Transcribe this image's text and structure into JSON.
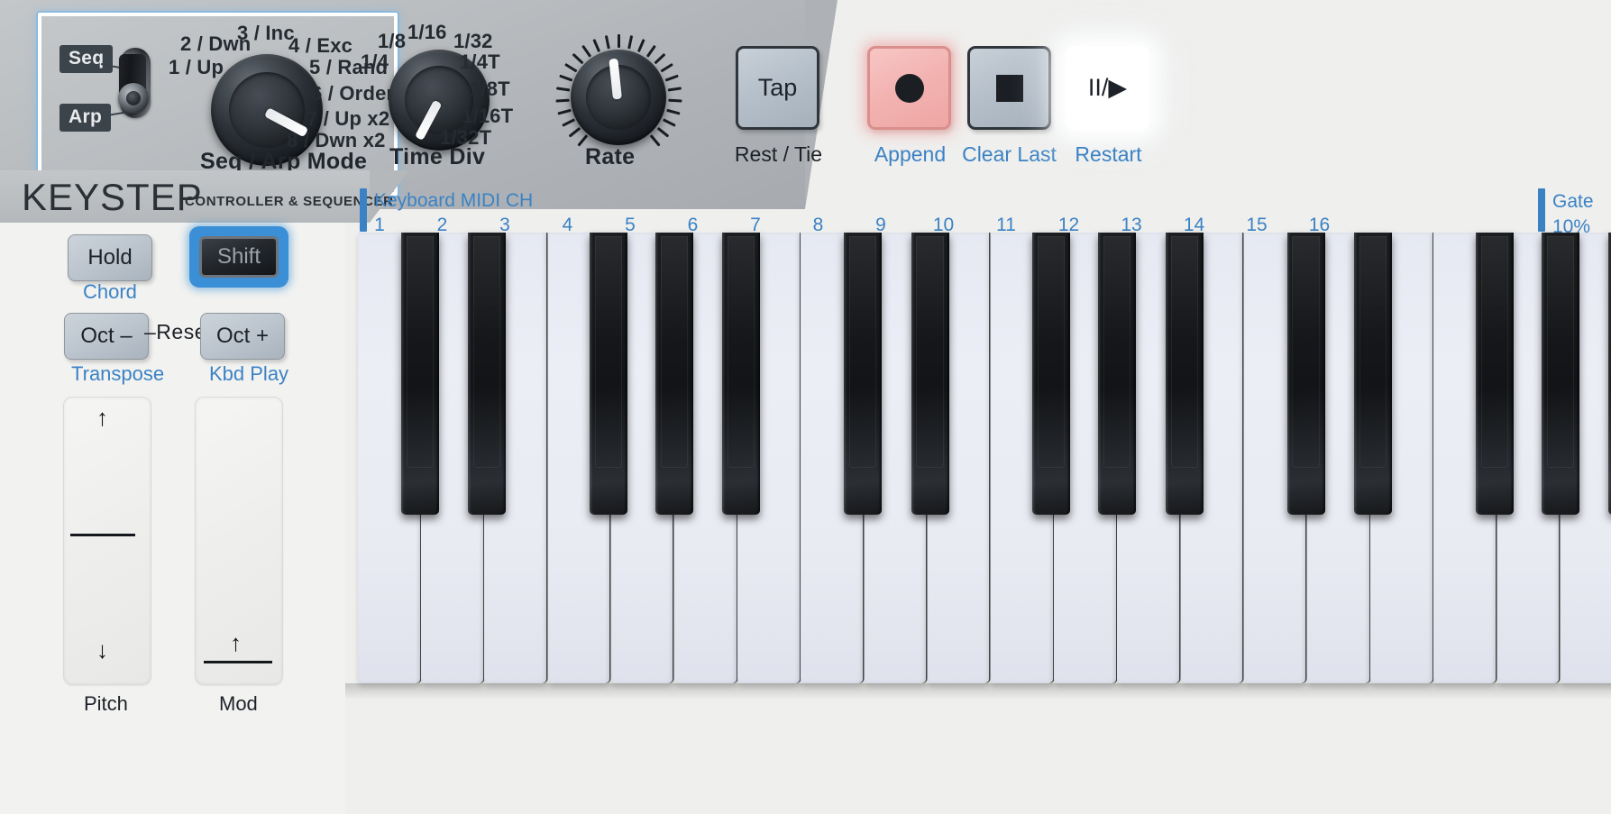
{
  "device": {
    "brand_name": "KEYSTEP",
    "brand_subtitle": "CONTROLLER & SEQUENCER"
  },
  "seq_arp_section": {
    "panel_title": "Seq / Arp Mode",
    "toggle": {
      "top_label": "Seq",
      "bottom_label": "Arp",
      "position": "Arp"
    },
    "mode_options": [
      "1 / Up",
      "2 / Dwn",
      "3 / Inc",
      "4 / Exc",
      "5 / Rand",
      "6 / Order",
      "7 / Up x2",
      "8 / Dwn x2"
    ]
  },
  "time_div_section": {
    "title": "Time Div",
    "options": [
      "1/4",
      "1/8",
      "1/16",
      "1/32",
      "1/4T",
      "1/8T",
      "1/16T",
      "1/32T"
    ]
  },
  "rate_section": {
    "title": "Rate"
  },
  "transport": {
    "buttons": [
      {
        "label": "Tap",
        "icon": "text",
        "caption": "Rest / Tie",
        "caption_color": "#1d2228",
        "state": "normal"
      },
      {
        "label": "",
        "icon": "record-icon",
        "caption": "Append",
        "caption_color": "#3b82c4",
        "state": "lit-red"
      },
      {
        "label": "",
        "icon": "stop-icon",
        "caption": "Clear Last",
        "caption_color": "#3b82c4",
        "state": "normal"
      },
      {
        "label": "II/▶",
        "icon": "pause-play-icon",
        "caption": "Restart",
        "caption_color": "#3b82c4",
        "state": "lit-white"
      }
    ]
  },
  "left_controls": {
    "hold_button": {
      "label": "Hold",
      "sub_label": "Chord"
    },
    "shift_button": {
      "label": "Shift",
      "state": "highlighted"
    },
    "oct_minus_button": {
      "label": "Oct –",
      "sub_label": "Transpose"
    },
    "oct_plus_button": {
      "label": "Oct +",
      "sub_label": "Kbd Play"
    },
    "reset_label": "–Reset–",
    "pitch_strip": {
      "label": "Pitch",
      "up_arrow": "↑",
      "down_arrow": "↓"
    },
    "mod_strip": {
      "label": "Mod",
      "up_arrow": "↑"
    }
  },
  "midi_channel_row": {
    "header": "Keyboard MIDI CH",
    "channels": [
      "1",
      "2",
      "3",
      "4",
      "5",
      "6",
      "7",
      "8",
      "9",
      "10",
      "11",
      "12",
      "13",
      "14",
      "15",
      "16"
    ]
  },
  "gate": {
    "label": "Gate",
    "value": "10%"
  },
  "colors": {
    "accent_blue": "#3b82c4",
    "highlight_blue": "#3b8fd6",
    "record_red": "#f2b2b0",
    "panel_grey": "#b4b8bb",
    "body_white": "#f2f2f0"
  }
}
